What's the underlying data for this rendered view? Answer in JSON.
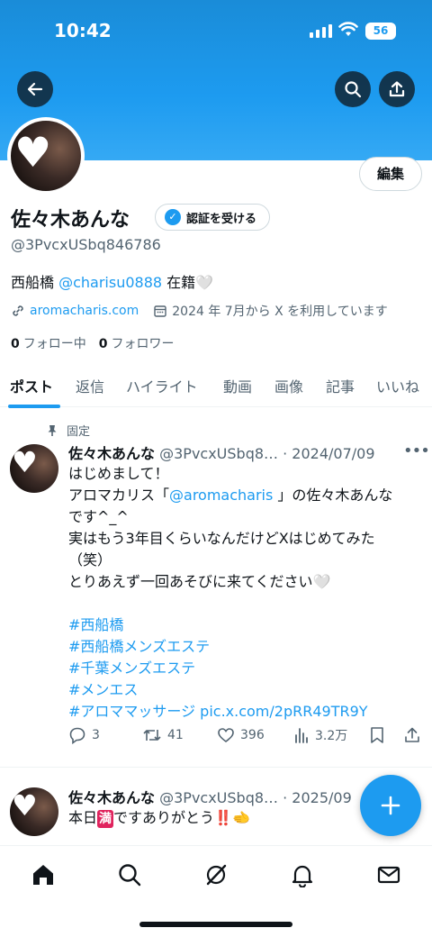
{
  "status_bar": {
    "time": "10:42",
    "battery": "56"
  },
  "profile": {
    "edit_label": "編集",
    "name": "佐々木あんな",
    "verify_label": "認証を受ける",
    "handle": "@3PvcxUSbq846786",
    "bio_before": "西船橋 ",
    "bio_mention": "@charisu0888",
    "bio_after": " 在籍🤍",
    "website": "aromacharis.com",
    "joined": "2024 年 7月から X を利用しています",
    "following_count": "0",
    "following_label": "フォロー中",
    "followers_count": "0",
    "followers_label": "フォロワー"
  },
  "tabs": [
    "ポスト",
    "返信",
    "ハイライト",
    "動画",
    "画像",
    "記事",
    "いいね"
  ],
  "pinned_post": {
    "pinned_label": "固定",
    "author": "佐々木あんな",
    "handle_date": "@3PvcxUSbq8… · 2024/07/09",
    "line1": "はじめまして！",
    "line2_before": "アロマカリス「",
    "line2_mention": "@aromacharis",
    "line2_after": " 」の佐々木あんな",
    "line3": "です^_^",
    "line4": "実はもう3年目くらいなんだけどXはじめてみた",
    "line5": "（笑）",
    "line6": "とりあえず一回あそびに来てください🤍",
    "hashtags": [
      "#西船橋",
      "#西船橋メンズエステ",
      "#千葉メンズエステ",
      "#メンエス"
    ],
    "last_tag": "#アロママッサージ",
    "pic_link": " pic.x.com/2pRR49TR9Y",
    "replies": "3",
    "reposts": "41",
    "likes": "396",
    "views": "3.2万"
  },
  "second_post": {
    "author": "佐々木あんな",
    "handle_date": "@3PvcxUSbq8… · 2025/09",
    "text_before": "本日",
    "text_badge": "満",
    "text_after": "ですありがとう‼️🫲"
  },
  "colors": {
    "accent": "#1d9bf0",
    "banner": "#1d9bf0",
    "text": "#0f1419",
    "muted": "#536471"
  }
}
